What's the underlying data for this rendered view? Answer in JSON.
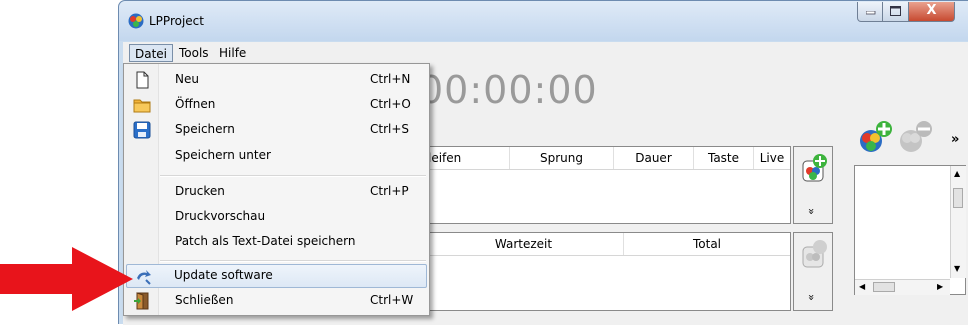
{
  "window": {
    "title": "LPProject",
    "close_glyph": "X"
  },
  "menubar": {
    "items": [
      "Datei",
      "Tools",
      "Hilfe"
    ]
  },
  "main": {
    "timer": "00:00:00",
    "table1_headers": [
      "leifen",
      "Sprung",
      "Dauer",
      "Taste",
      "Live"
    ],
    "table2_headers": [
      "Wartezeit",
      "Total"
    ],
    "more_glyph": "»",
    "chevron_glyph": "»"
  },
  "dropdown": {
    "items": [
      {
        "label": "Neu",
        "shortcut": "Ctrl+N",
        "icon": "new-file-icon"
      },
      {
        "label": "Öffnen",
        "shortcut": "Ctrl+O",
        "icon": "folder-icon"
      },
      {
        "label": "Speichern",
        "shortcut": "Ctrl+S",
        "icon": "floppy-disk-icon"
      },
      {
        "label": "Speichern unter",
        "shortcut": "",
        "icon": ""
      },
      {
        "label": "Drucken",
        "shortcut": "Ctrl+P",
        "icon": ""
      },
      {
        "label": "Druckvorschau",
        "shortcut": "",
        "icon": ""
      },
      {
        "label": "Patch als Text-Datei speichern",
        "shortcut": "",
        "icon": ""
      },
      {
        "label": "Update software",
        "shortcut": "",
        "icon": "update-arrow-icon"
      },
      {
        "label": "Schließen",
        "shortcut": "Ctrl+W",
        "icon": "exit-door-icon"
      }
    ]
  },
  "colors": {
    "accent_red": "#e8141b",
    "highlight": "#dde8f5",
    "titlebar": "#c9dcef"
  }
}
